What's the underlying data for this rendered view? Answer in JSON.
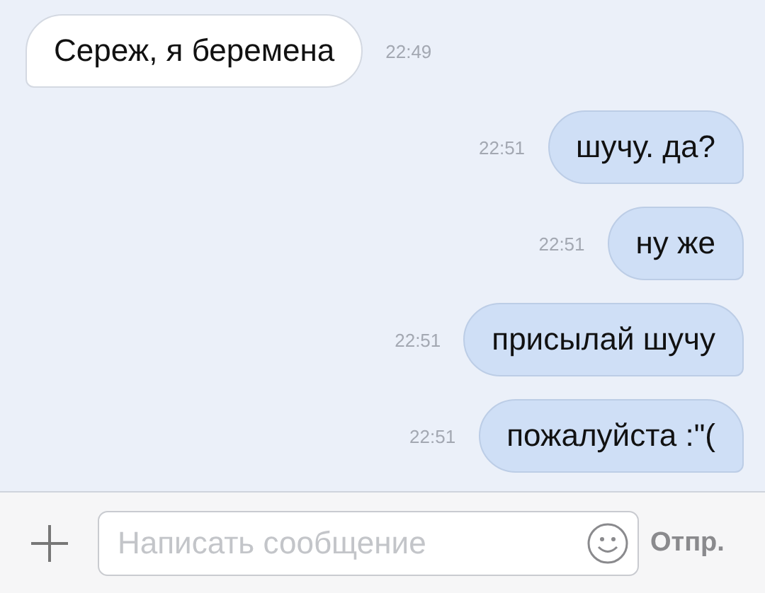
{
  "messages": [
    {
      "kind": "incoming",
      "text": "Сереж, я беремена",
      "time": "22:49"
    },
    {
      "kind": "outgoing",
      "text": "шучу. да?",
      "time": "22:51"
    },
    {
      "kind": "outgoing",
      "text": "ну же",
      "time": "22:51"
    },
    {
      "kind": "outgoing",
      "text": "присылай шучу",
      "time": "22:51"
    },
    {
      "kind": "outgoing",
      "text": "пожалуйста :\"(",
      "time": "22:51"
    }
  ],
  "composer": {
    "placeholder": "Написать сообщение",
    "send_label": "Отпр."
  }
}
